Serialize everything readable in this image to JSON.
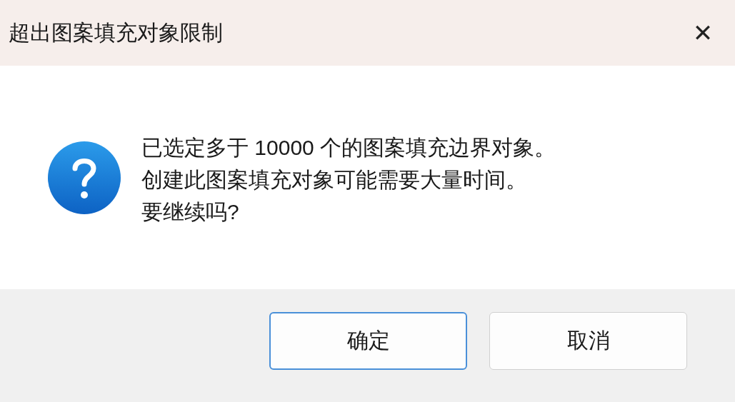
{
  "window": {
    "title": "超出图案填充对象限制",
    "close": "✕"
  },
  "message": {
    "lines": [
      "已选定多于 10000 个的图案填充边界对象。",
      "创建此图案填充对象可能需要大量时间。",
      "要继续吗?"
    ]
  },
  "buttons": [
    {
      "label": "确定",
      "default": true
    },
    {
      "label": "取消",
      "default": false
    }
  ]
}
